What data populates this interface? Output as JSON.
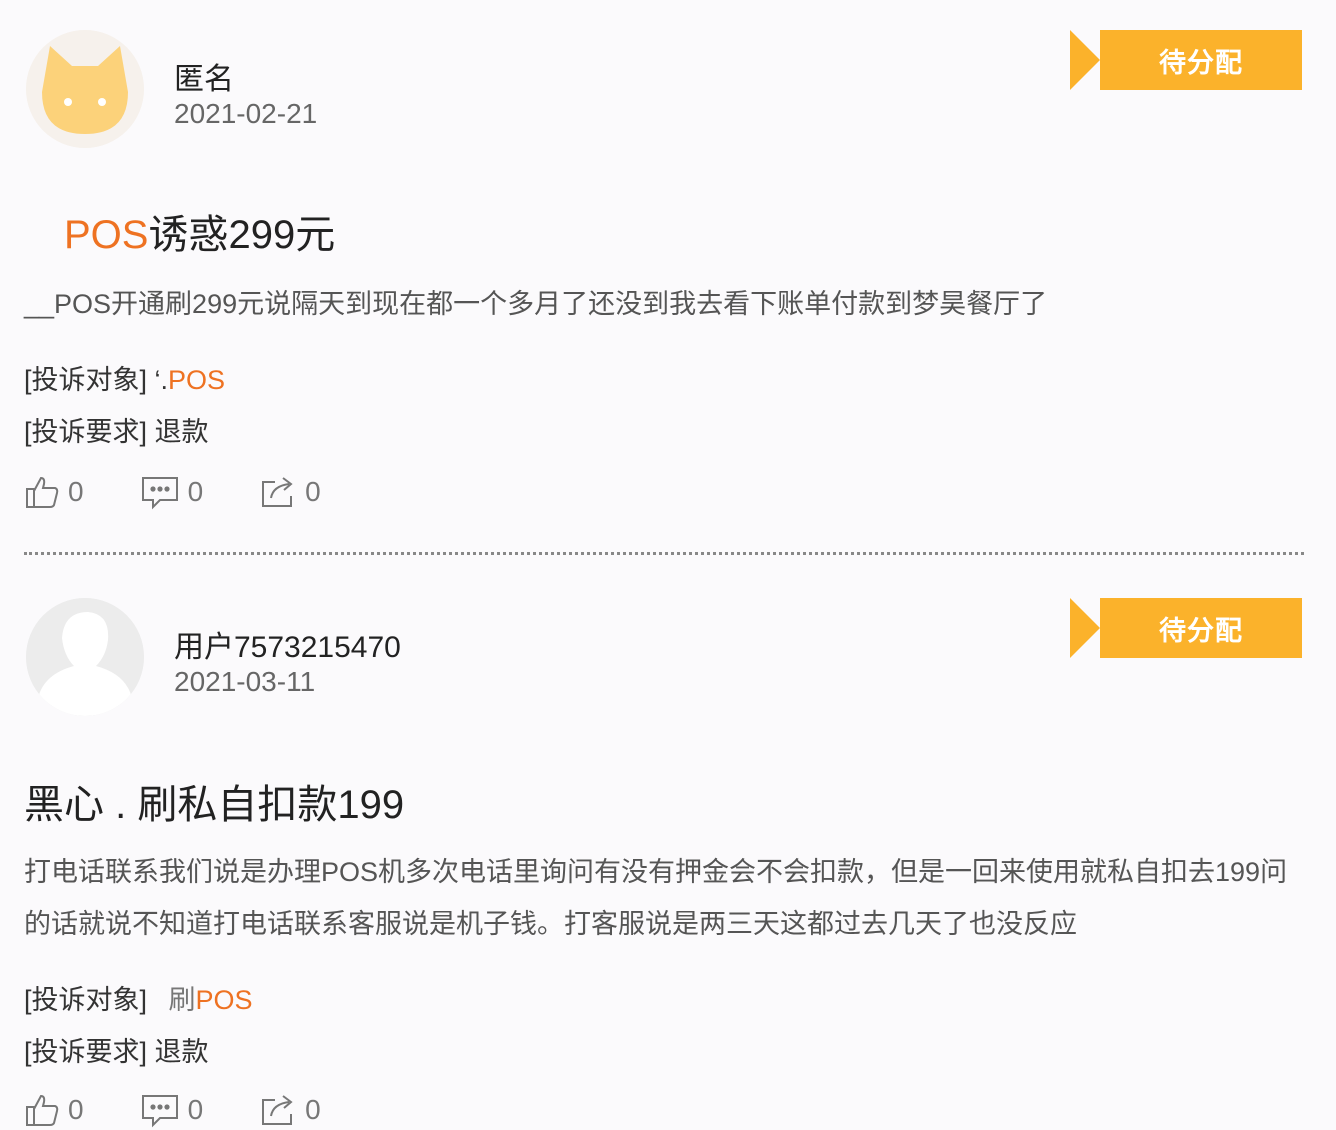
{
  "status_color": "#fbb22b",
  "accent_color": "#ee7222",
  "complaints": [
    {
      "user": "匿名",
      "date": "2021-02-21",
      "status": "待分配",
      "title_highlight": "POS",
      "title_rest": "诱惑299元",
      "content": "__POS开通刷299元说隔天到现在都一个多月了还没到我去看下账单付款到梦昊餐厅了",
      "target_label": "[投诉对象]",
      "target_prefix": "‘.",
      "target_value": "POS",
      "demand_label": "[投诉要求]",
      "demand_value": "退款",
      "likes": "0",
      "comments": "0",
      "shares": "0",
      "avatar_icon": "cat-avatar-icon"
    },
    {
      "user": "用户7573215470",
      "date": "2021-03-11",
      "status": "待分配",
      "title_text": "黑心 . 刷私自扣款199",
      "content": "打电话联系我们说是办理POS机多次电话里询问有没有押金会不会扣款，但是一回来使用就私自扣去199问的话就说不知道打电话联系客服说是机子钱。打客服说是两三天这都过去几天了也没反应",
      "target_label": "[投诉对象]",
      "target_prefix": "刷",
      "target_value": "POS",
      "demand_label": "[投诉要求]",
      "demand_value": "退款",
      "likes": "0",
      "comments": "0",
      "shares": "0",
      "avatar_icon": "default-user-avatar-icon"
    }
  ]
}
